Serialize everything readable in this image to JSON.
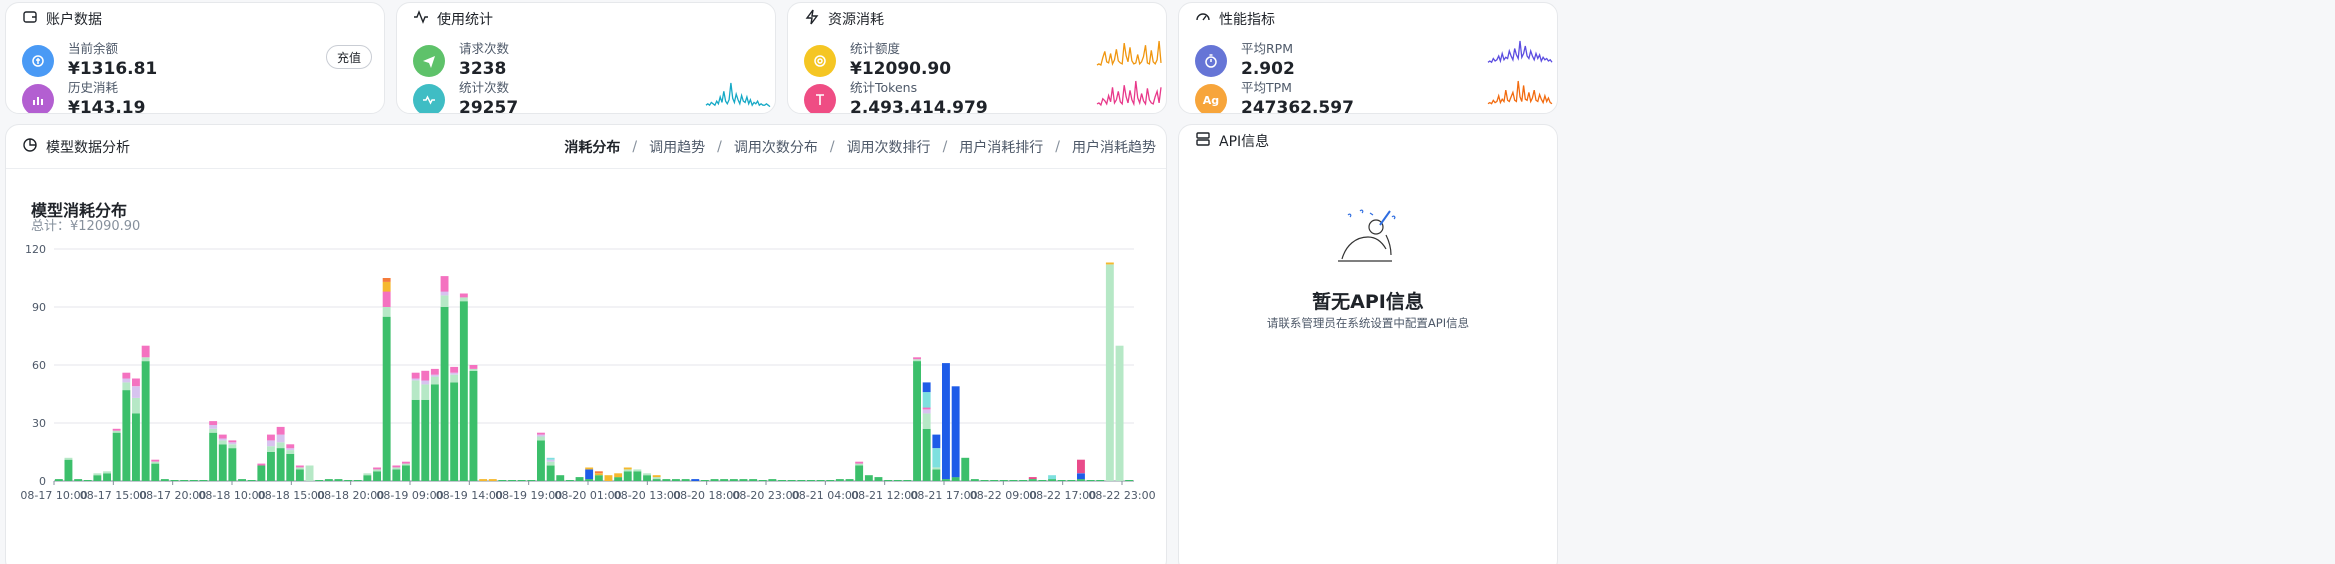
{
  "account": {
    "title": "账户数据",
    "balance_label": "当前余额",
    "balance_value": "¥1316.81",
    "recharge_label": "充值",
    "history_label": "历史消耗",
    "history_value": "¥143.19"
  },
  "usage": {
    "title": "使用统计",
    "requests_label": "请求次数",
    "requests_value": "3238",
    "stat_count_label": "统计次数",
    "stat_count_value": "29257"
  },
  "resource": {
    "title": "资源消耗",
    "quota_label": "统计额度",
    "quota_value": "¥12090.90",
    "tokens_label": "统计Tokens",
    "tokens_value": "2,493,414,979"
  },
  "performance": {
    "title": "性能指标",
    "rpm_label": "平均RPM",
    "rpm_value": "2.902",
    "tpm_label": "平均TPM",
    "tpm_value": "247362.597",
    "tpm_icon_text": "Ag"
  },
  "analysis": {
    "title": "模型数据分析",
    "tabs": [
      "消耗分布",
      "调用趋势",
      "调用次数分布",
      "调用次数排行",
      "用户消耗排行",
      "用户消耗趋势"
    ],
    "separator": "/"
  },
  "api_info": {
    "title": "API信息",
    "empty_title": "暂无API信息",
    "empty_desc": "请联系管理员在系统设置中配置API信息"
  },
  "colors": {
    "blue": "#4a9af5",
    "purple": "#b35fd1",
    "green": "#5ec26a",
    "teal": "#3fbdc4",
    "yellow": "#f5c623",
    "pink": "#ef4d84",
    "indigo": "#6675d6",
    "orange": "#f7a53b",
    "spark_teal": "#16a9c6",
    "spark_orange": "#f0960f",
    "spark_pink": "#e8388a",
    "spark_purple": "#5b4de0",
    "spark_deep_orange": "#f26b0f"
  },
  "chart_data": {
    "type": "bar",
    "title": "模型消耗分布",
    "subtitle": "总计：¥12090.90",
    "ylim": [
      0,
      120
    ],
    "yticks": [
      0,
      30,
      60,
      90,
      120
    ],
    "xticks": [
      "08-17 10:00",
      "08-17 15:00",
      "08-17 20:00",
      "08-18 10:00",
      "08-18 15:00",
      "08-18 20:00",
      "08-19 09:00",
      "08-19 14:00",
      "08-19 19:00",
      "08-20 01:00",
      "08-20 13:00",
      "08-20 18:00",
      "08-20 23:00",
      "08-21 04:00",
      "08-21 12:00",
      "08-21 17:00",
      "08-22 09:00",
      "08-22 17:00",
      "08-22 23:00"
    ],
    "series": [
      {
        "color": "#3cbf6b",
        "values": [
          1,
          11,
          1,
          0,
          3,
          4,
          25,
          47,
          35,
          62,
          9,
          1,
          0,
          0,
          0,
          0,
          25,
          19,
          17,
          1,
          0,
          8,
          15,
          17,
          14,
          6,
          0,
          0,
          1,
          1,
          0,
          0,
          3,
          5,
          85,
          6,
          8,
          42,
          42,
          50,
          90,
          51,
          93,
          57,
          0,
          0,
          0,
          0,
          0,
          0,
          21,
          8,
          3,
          0,
          2,
          1,
          3,
          0,
          2,
          5,
          5,
          3,
          1,
          1,
          1,
          1,
          0,
          0,
          1,
          1,
          1,
          1,
          1,
          0,
          1,
          0,
          0,
          0,
          0,
          0,
          0,
          1,
          1,
          8,
          3,
          2,
          0,
          0,
          0,
          62,
          27,
          6,
          1,
          2,
          12,
          1,
          0,
          0,
          0,
          0,
          0,
          1,
          0,
          1,
          0,
          0,
          1,
          0,
          0,
          0,
          0,
          0
        ]
      },
      {
        "color": "#b6e8c6",
        "values": [
          0,
          1,
          0,
          0,
          1,
          1,
          1,
          4,
          8,
          2,
          1,
          0,
          0,
          0,
          0,
          0,
          2,
          2,
          2,
          0,
          0,
          0,
          3,
          3,
          2,
          1,
          8,
          0,
          0,
          0,
          0,
          0,
          1,
          1,
          5,
          1,
          1,
          10,
          8,
          4,
          6,
          4,
          2,
          1,
          0,
          0,
          0,
          0,
          0,
          0,
          2,
          2,
          0,
          0,
          0,
          0,
          0,
          0,
          0,
          1,
          1,
          1,
          1,
          0,
          0,
          0,
          0,
          0,
          0,
          0,
          0,
          0,
          0,
          0,
          0,
          0,
          0,
          0,
          0,
          0,
          0,
          0,
          0,
          1,
          0,
          0,
          0,
          0,
          0,
          1,
          8,
          1,
          0,
          0,
          0,
          0,
          0,
          0,
          0,
          0,
          0,
          0,
          0,
          0,
          0,
          0,
          0,
          0,
          0,
          112,
          70,
          0
        ]
      },
      {
        "color": "#d7c3ef",
        "values": [
          0,
          0,
          0,
          0,
          0,
          0,
          0,
          2,
          6,
          0,
          0,
          0,
          0,
          0,
          0,
          0,
          2,
          1,
          1,
          0,
          0,
          0,
          3,
          4,
          1,
          0,
          0,
          0,
          0,
          0,
          0,
          0,
          0,
          0,
          0,
          0,
          0,
          1,
          2,
          1,
          2,
          1,
          0,
          0,
          0,
          0,
          0,
          0,
          0,
          0,
          1,
          1,
          0,
          0,
          0,
          0,
          0,
          0,
          0,
          0,
          0,
          0,
          0,
          0,
          0,
          0,
          0,
          0,
          0,
          0,
          0,
          0,
          0,
          0,
          0,
          0,
          0,
          0,
          0,
          0,
          0,
          0,
          0,
          0,
          0,
          0,
          0,
          0,
          0,
          0,
          2,
          0,
          0,
          0,
          0,
          0,
          0,
          0,
          0,
          0,
          0,
          0,
          0,
          0,
          0,
          0,
          0,
          0,
          0,
          0,
          0,
          0
        ]
      },
      {
        "color": "#f472c0",
        "values": [
          0,
          0,
          0,
          0,
          0,
          0,
          1,
          3,
          4,
          6,
          1,
          0,
          0,
          0,
          0,
          0,
          2,
          2,
          1,
          0,
          0,
          1,
          3,
          4,
          2,
          1,
          0,
          0,
          0,
          0,
          0,
          0,
          0,
          1,
          8,
          1,
          1,
          3,
          5,
          3,
          8,
          3,
          2,
          2,
          0,
          0,
          0,
          0,
          0,
          0,
          1,
          0,
          0,
          0,
          0,
          0,
          0,
          0,
          0,
          0,
          0,
          0,
          0,
          0,
          0,
          0,
          0,
          0,
          0,
          0,
          0,
          0,
          0,
          0,
          0,
          0,
          0,
          0,
          0,
          0,
          0,
          0,
          0,
          1,
          0,
          0,
          0,
          0,
          0,
          1,
          1,
          0,
          0,
          0,
          0,
          0,
          0,
          0,
          0,
          0,
          0,
          0,
          0,
          0,
          0,
          0,
          0,
          0,
          0,
          0,
          0,
          0
        ]
      },
      {
        "color": "#7ee0df",
        "values": [
          0,
          0,
          0,
          0,
          0,
          0,
          0,
          0,
          0,
          0,
          0,
          0,
          0,
          0,
          0,
          0,
          0,
          0,
          0,
          0,
          0,
          0,
          0,
          0,
          0,
          0,
          0,
          0,
          0,
          0,
          0,
          0,
          0,
          0,
          0,
          0,
          0,
          0,
          0,
          0,
          0,
          0,
          0,
          0,
          0,
          0,
          0,
          0,
          0,
          0,
          0,
          1,
          0,
          0,
          0,
          0,
          0,
          0,
          0,
          0,
          0,
          0,
          0,
          0,
          0,
          0,
          0,
          0,
          0,
          0,
          0,
          0,
          0,
          0,
          0,
          0,
          0,
          0,
          0,
          0,
          0,
          0,
          0,
          0,
          0,
          0,
          0,
          0,
          0,
          0,
          8,
          10,
          0,
          0,
          0,
          0,
          0,
          0,
          0,
          0,
          0,
          0,
          0,
          2,
          0,
          0,
          0,
          0,
          0,
          0,
          0,
          0
        ]
      },
      {
        "color": "#1e5ce8",
        "values": [
          0,
          0,
          0,
          0,
          0,
          0,
          0,
          0,
          0,
          0,
          0,
          0,
          0,
          0,
          0,
          0,
          0,
          0,
          0,
          0,
          0,
          0,
          0,
          0,
          0,
          0,
          0,
          0,
          0,
          0,
          0,
          0,
          0,
          0,
          0,
          0,
          0,
          0,
          0,
          0,
          0,
          0,
          0,
          0,
          0,
          0,
          0,
          0,
          0,
          0,
          0,
          0,
          0,
          0,
          0,
          5,
          0,
          0,
          0,
          0,
          0,
          0,
          0,
          0,
          0,
          0,
          1,
          0,
          0,
          0,
          0,
          0,
          0,
          0,
          0,
          0,
          0,
          0,
          0,
          0,
          0,
          0,
          0,
          0,
          0,
          0,
          0,
          0,
          0,
          0,
          5,
          7,
          60,
          47,
          0,
          0,
          0,
          0,
          0,
          0,
          0,
          0,
          0,
          0,
          0,
          0,
          3,
          0,
          0,
          0,
          0,
          0
        ]
      },
      {
        "color": "#f5b82e",
        "values": [
          0,
          0,
          0,
          0,
          0,
          0,
          0,
          0,
          0,
          0,
          0,
          0,
          0,
          0,
          0,
          0,
          0,
          0,
          0,
          0,
          0,
          0,
          0,
          0,
          0,
          0,
          0,
          0,
          0,
          0,
          0,
          0,
          0,
          0,
          5,
          0,
          0,
          0,
          0,
          0,
          0,
          0,
          0,
          0,
          1,
          1,
          0,
          0,
          0,
          0,
          0,
          0,
          0,
          0,
          0,
          1,
          1,
          3,
          2,
          1,
          0,
          0,
          1,
          0,
          0,
          0,
          0,
          0,
          0,
          0,
          0,
          0,
          0,
          0,
          0,
          0,
          0,
          0,
          0,
          0,
          0,
          0,
          0,
          0,
          0,
          0,
          0,
          0,
          0,
          0,
          0,
          0,
          0,
          0,
          0,
          0,
          0,
          0,
          0,
          0,
          0,
          0,
          0,
          0,
          0,
          0,
          0,
          0,
          0,
          1,
          0,
          0
        ]
      },
      {
        "color": "#f57b3a",
        "values": [
          0,
          0,
          0,
          0,
          0,
          0,
          0,
          0,
          0,
          0,
          0,
          0,
          0,
          0,
          0,
          0,
          0,
          0,
          0,
          0,
          0,
          0,
          0,
          0,
          0,
          0,
          0,
          0,
          0,
          0,
          0,
          0,
          0,
          0,
          2,
          0,
          0,
          0,
          0,
          0,
          0,
          0,
          0,
          0,
          0,
          0,
          0,
          0,
          0,
          0,
          0,
          0,
          0,
          0,
          0,
          0,
          1,
          0,
          0,
          0,
          0,
          0,
          0,
          0,
          0,
          0,
          0,
          0,
          0,
          0,
          0,
          0,
          0,
          0,
          0,
          0,
          0,
          0,
          0,
          0,
          0,
          0,
          0,
          0,
          0,
          0,
          0,
          0,
          0,
          0,
          0,
          0,
          0,
          0,
          0,
          0,
          0,
          0,
          0,
          0,
          0,
          0,
          0,
          0,
          0,
          0,
          0,
          0,
          0,
          0,
          0,
          0
        ]
      },
      {
        "color": "#e94b8a",
        "values": [
          0,
          0,
          0,
          0,
          0,
          0,
          0,
          0,
          0,
          0,
          0,
          0,
          0,
          0,
          0,
          0,
          0,
          0,
          0,
          0,
          0,
          0,
          0,
          0,
          0,
          0,
          0,
          0,
          0,
          0,
          0,
          0,
          0,
          0,
          0,
          0,
          0,
          0,
          0,
          0,
          0,
          0,
          0,
          0,
          0,
          0,
          0,
          0,
          0,
          0,
          0,
          0,
          0,
          0,
          0,
          0,
          0,
          0,
          0,
          0,
          0,
          0,
          0,
          0,
          0,
          0,
          0,
          0,
          0,
          0,
          0,
          0,
          0,
          0,
          0,
          0,
          0,
          0,
          0,
          0,
          0,
          0,
          0,
          0,
          0,
          0,
          0,
          0,
          0,
          0,
          0,
          0,
          0,
          0,
          0,
          0,
          0,
          0,
          0,
          0,
          0,
          1,
          0,
          0,
          0,
          0,
          7,
          0,
          0,
          0,
          0,
          0
        ]
      }
    ]
  },
  "sparklines": {
    "usage": [
      2,
      3,
      2,
      4,
      3,
      2,
      5,
      3,
      8,
      4,
      12,
      5,
      3,
      6,
      18,
      7,
      4,
      10,
      6,
      3,
      9,
      5,
      4,
      8,
      3,
      6,
      2,
      4,
      3,
      5,
      2,
      3,
      2,
      2,
      3,
      2,
      1
    ],
    "quota": [
      1,
      2,
      1,
      8,
      14,
      4,
      3,
      12,
      2,
      6,
      16,
      5,
      3,
      2,
      22,
      10,
      4,
      18,
      5,
      2,
      3,
      11,
      2,
      4,
      9,
      20,
      3,
      2,
      15,
      4,
      2,
      6,
      24,
      3
    ],
    "tokens": [
      2,
      3,
      1,
      7,
      5,
      2,
      10,
      4,
      18,
      3,
      6,
      14,
      4,
      2,
      20,
      9,
      3,
      15,
      6,
      2,
      24,
      8,
      3,
      12,
      5,
      2,
      17,
      6,
      3,
      2,
      9,
      14,
      3,
      18
    ],
    "rpm": [
      3,
      4,
      3,
      6,
      4,
      5,
      8,
      4,
      10,
      5,
      7,
      6,
      12,
      8,
      5,
      14,
      9,
      6,
      20,
      7,
      10,
      16,
      8,
      6,
      12,
      8,
      5,
      10,
      6,
      9,
      4,
      7,
      5,
      6,
      4,
      5,
      3
    ],
    "tpm": [
      2,
      3,
      2,
      5,
      3,
      4,
      9,
      3,
      6,
      4,
      14,
      5,
      4,
      8,
      12,
      5,
      4,
      22,
      8,
      4,
      18,
      6,
      5,
      12,
      4,
      7,
      14,
      5,
      4,
      10,
      6,
      3,
      9,
      4,
      7,
      3,
      2
    ]
  }
}
